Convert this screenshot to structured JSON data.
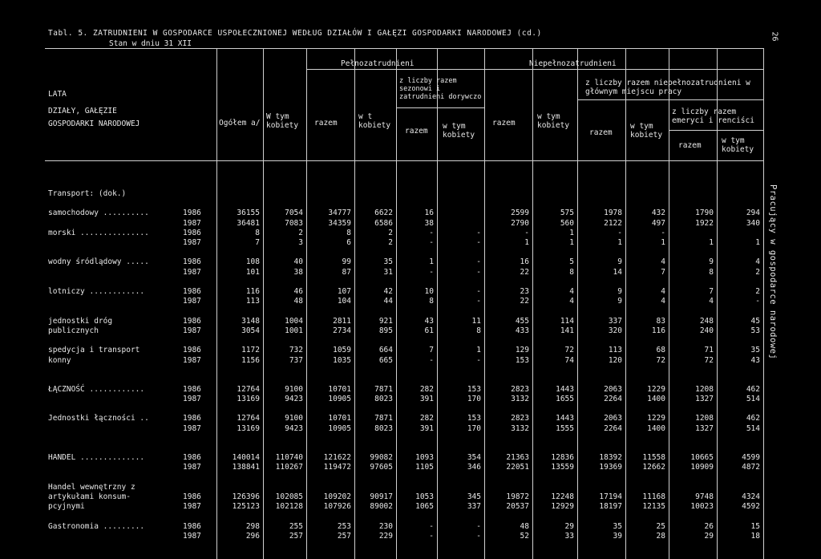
{
  "page": {
    "title": "Tabl. 5.   ZATRUDNIENI W GOSPODARCE USPOŁECZNIONEJ WEDŁUG DZIAŁÓW I GAŁĘZI GOSPODARKI NARODOWEJ  (cd.)",
    "subtitle": "Stan w dniu 31 XII",
    "page_number": "26",
    "side_text": "Pracujący w gospodarce narodowej"
  },
  "header": {
    "rowlabel_1": "LATA",
    "rowlabel_2": "DZIAŁY, GAŁĘZIE",
    "rowlabel_3": "GOSPODARKI NARODOWEJ",
    "ogolem": "Ogółem a/",
    "w_tym_kobiety": "W tym kobiety",
    "pelno": "Pełnozatrudnieni",
    "niepelno": "Niepełnozatrudnieni",
    "razem": "razem",
    "wt_kobiety": "w t kobiety",
    "sezonowi": "z liczby razem sezonowi i zatrudnieni dorywczo",
    "np_glowne": "z liczby razem niepełnozatrudnieni w głównym miejscu pracy",
    "emeryci": "z liczby razem emeryci i renciści",
    "w_tym": "w tym kobiety",
    "razem_sub": "razem",
    "w_tym_kobiety_sub": "w tym kobiety"
  },
  "rows": [
    {
      "label": "Transport: (dok.)",
      "year": "",
      "v": []
    },
    {
      "gap": true
    },
    {
      "label": "samochodowy ..........",
      "year": "1986",
      "v": [
        "36155",
        "7054",
        "34777",
        "6622",
        "16",
        "",
        "2599",
        "575",
        "1978",
        "432",
        "1790",
        "294"
      ]
    },
    {
      "label": "",
      "year": "1987",
      "v": [
        "36481",
        "7083",
        "34359",
        "6586",
        "38",
        "",
        "2790",
        "560",
        "2122",
        "497",
        "1922",
        "340"
      ]
    },
    {
      "label": "morski ...............",
      "year": "1986",
      "v": [
        "8",
        "2",
        "8",
        "2",
        "-",
        "-",
        "-",
        "1",
        "-",
        "-",
        "",
        ""
      ]
    },
    {
      "label": "",
      "year": "1987",
      "v": [
        "7",
        "3",
        "6",
        "2",
        "-",
        "-",
        "1",
        "1",
        "1",
        "1",
        "1",
        "1"
      ]
    },
    {
      "gap": true
    },
    {
      "label": "wodny śródlądowy .....",
      "year": "1986",
      "v": [
        "108",
        "40",
        "99",
        "35",
        "1",
        "-",
        "16",
        "5",
        "9",
        "4",
        "9",
        "4"
      ]
    },
    {
      "label": "",
      "year": "1987",
      "v": [
        "101",
        "38",
        "87",
        "31",
        "-",
        "-",
        "22",
        "8",
        "14",
        "7",
        "8",
        "2"
      ]
    },
    {
      "gap": true
    },
    {
      "label": "lotniczy ............",
      "year": "1986",
      "v": [
        "116",
        "46",
        "107",
        "42",
        "10",
        "-",
        "23",
        "4",
        "9",
        "4",
        "7",
        "2"
      ]
    },
    {
      "label": "",
      "year": "1987",
      "v": [
        "113",
        "48",
        "104",
        "44",
        "8",
        "-",
        "22",
        "4",
        "9",
        "4",
        "4",
        "-"
      ]
    },
    {
      "gap": true
    },
    {
      "label": "jednostki dróg",
      "year": "1986",
      "v": [
        "3148",
        "1004",
        "2811",
        "921",
        "43",
        "11",
        "455",
        "114",
        "337",
        "83",
        "248",
        "45"
      ]
    },
    {
      "label": "publicznych",
      "year": "1987",
      "v": [
        "3054",
        "1001",
        "2734",
        "895",
        "61",
        "8",
        "433",
        "141",
        "320",
        "116",
        "240",
        "53"
      ]
    },
    {
      "gap": true
    },
    {
      "label": "spedycja i transport",
      "year": "1986",
      "v": [
        "1172",
        "732",
        "1059",
        "664",
        "7",
        "1",
        "129",
        "72",
        "113",
        "68",
        "71",
        "35"
      ]
    },
    {
      "label": "konny",
      "year": "1987",
      "v": [
        "1156",
        "737",
        "1035",
        "665",
        "-",
        "-",
        "153",
        "74",
        "120",
        "72",
        "72",
        "43"
      ]
    },
    {
      "gap": true
    },
    {
      "gap": true
    },
    {
      "label": "ŁĄCZNOŚĆ ............",
      "year": "1986",
      "v": [
        "12764",
        "9100",
        "10701",
        "7871",
        "282",
        "153",
        "2823",
        "1443",
        "2063",
        "1229",
        "1208",
        "462"
      ]
    },
    {
      "label": "",
      "year": "1987",
      "v": [
        "13169",
        "9423",
        "10905",
        "8023",
        "391",
        "170",
        "3132",
        "1655",
        "2264",
        "1400",
        "1327",
        "514"
      ]
    },
    {
      "gap": true
    },
    {
      "label": "Jednostki łączności ..",
      "year": "1986",
      "v": [
        "12764",
        "9100",
        "10701",
        "7871",
        "282",
        "153",
        "2823",
        "1443",
        "2063",
        "1229",
        "1208",
        "462"
      ]
    },
    {
      "label": "",
      "year": "1987",
      "v": [
        "13169",
        "9423",
        "10905",
        "8023",
        "391",
        "170",
        "3132",
        "1555",
        "2264",
        "1400",
        "1327",
        "514"
      ]
    },
    {
      "gap": true
    },
    {
      "gap": true
    },
    {
      "label": "HANDEL ..............",
      "year": "1986",
      "v": [
        "140014",
        "110740",
        "121622",
        "99082",
        "1093",
        "354",
        "21363",
        "12836",
        "18392",
        "11558",
        "10665",
        "4599"
      ]
    },
    {
      "label": "",
      "year": "1987",
      "v": [
        "138841",
        "110267",
        "119472",
        "97605",
        "1105",
        "346",
        "22051",
        "13559",
        "19369",
        "12662",
        "10909",
        "4872"
      ]
    },
    {
      "gap": true
    },
    {
      "label": "Handel wewnętrzny z",
      "year": "",
      "v": []
    },
    {
      "label": "artykułami konsum-",
      "year": "1986",
      "v": [
        "126396",
        "102085",
        "109202",
        "90917",
        "1053",
        "345",
        "19872",
        "12248",
        "17194",
        "11168",
        "9748",
        "4324"
      ]
    },
    {
      "label": "pcyjnymi",
      "year": "1987",
      "v": [
        "125123",
        "102128",
        "107926",
        "89002",
        "1065",
        "337",
        "20537",
        "12929",
        "18197",
        "12135",
        "10023",
        "4592"
      ]
    },
    {
      "gap": true
    },
    {
      "label": "Gastronomia .........",
      "year": "1986",
      "v": [
        "298",
        "255",
        "253",
        "230",
        "-",
        "-",
        "48",
        "29",
        "35",
        "25",
        "26",
        "15"
      ]
    },
    {
      "label": "",
      "year": "1987",
      "v": [
        "296",
        "257",
        "257",
        "229",
        "-",
        "-",
        "52",
        "33",
        "39",
        "28",
        "29",
        "18"
      ]
    }
  ]
}
